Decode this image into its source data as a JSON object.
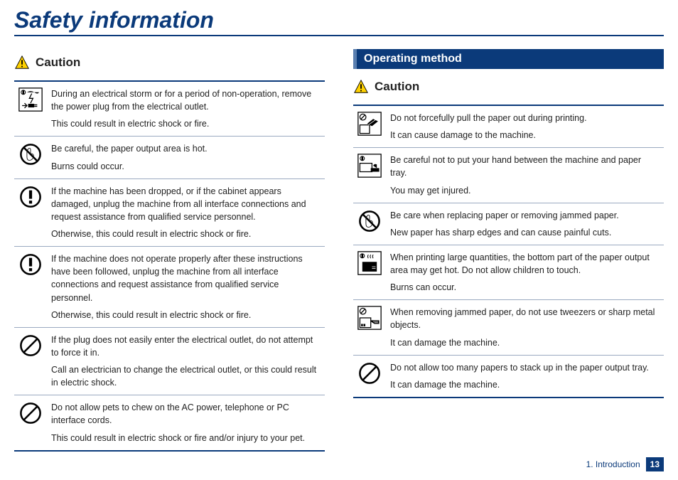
{
  "title": "Safety information",
  "caution_label": "Caution",
  "section_operating": "Operating method",
  "left": [
    {
      "icon": "storm",
      "lines": [
        "During an electrical storm or for a period of non-operation, remove the power plug from the electrical outlet.",
        "This could result in electric shock or fire."
      ]
    },
    {
      "icon": "nohand",
      "lines": [
        "Be careful, the paper output area is hot.",
        "Burns could occur."
      ]
    },
    {
      "icon": "excl",
      "lines": [
        "If the machine has been dropped, or if the cabinet appears damaged, unplug the machine from all interface connections and request assistance from qualified service personnel.",
        "Otherwise, this could result in electric shock or fire."
      ]
    },
    {
      "icon": "excl",
      "lines": [
        "If the machine does not operate properly after these instructions have been followed, unplug the machine from all interface connections and request assistance from qualified service personnel.",
        "Otherwise, this could result in electric shock or fire."
      ]
    },
    {
      "icon": "prohibit",
      "lines": [
        "If the plug does not easily enter the electrical outlet, do not attempt to force it in.",
        "Call an electrician to change the electrical outlet, or this could result in electric shock."
      ]
    },
    {
      "icon": "prohibit",
      "lines": [
        "Do not allow pets to chew on the AC power, telephone or PC interface cords.",
        "This could result in electric shock or fire and/or injury to your pet."
      ]
    }
  ],
  "right": [
    {
      "icon": "pullpaper",
      "lines": [
        "Do not forcefully pull the paper out during printing.",
        "It can cause damage to the machine."
      ]
    },
    {
      "icon": "handtray",
      "lines": [
        "Be careful not to put your hand between the machine and paper tray.",
        "You may get injured."
      ]
    },
    {
      "icon": "nohand",
      "lines": [
        "Be care when replacing paper or removing jammed paper.",
        "New paper has sharp edges and can cause painful cuts."
      ]
    },
    {
      "icon": "hotarea",
      "lines": [
        "When printing large quantities, the bottom part of the paper output area may get hot. Do not allow children to touch.",
        "Burns can occur."
      ]
    },
    {
      "icon": "tools",
      "lines": [
        "When removing jammed paper, do not use tweezers or sharp metal objects.",
        "It can damage the machine."
      ]
    },
    {
      "icon": "prohibit",
      "lines": [
        "Do not allow too many papers to stack up in the paper output tray.",
        "It can damage the machine."
      ]
    }
  ],
  "footer_chapter": "1. Introduction",
  "footer_page": "13"
}
